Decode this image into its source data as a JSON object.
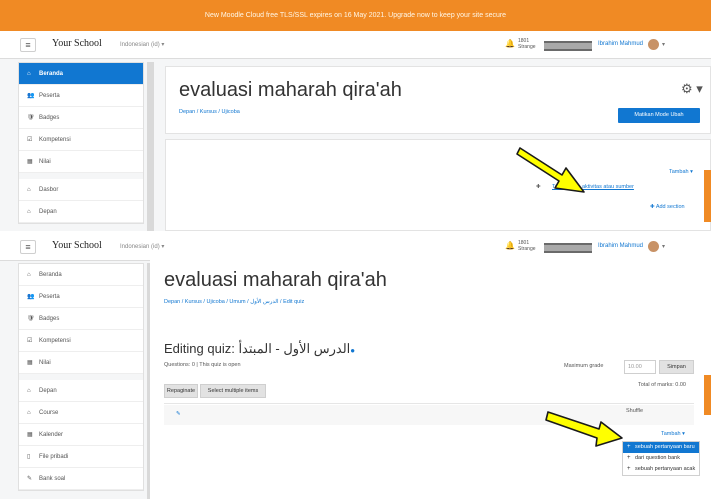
{
  "top": {
    "banner": "New Moodle Cloud free TLS/SSL expires on 16 May 2021. Upgrade now to keep your site secure",
    "navbar": {
      "toggle": "≡",
      "brand": "Your School",
      "lang": "Indonesian (id) ▾",
      "bell": "🔔",
      "chat": "💬",
      "userbox_l1": "1801",
      "userbox_l2": "Strange",
      "username": "Ibrahim Mahmud",
      "avatar_chev": "▾"
    },
    "drawer": [
      {
        "label": "Beranda",
        "icon": "⌂",
        "active": true
      },
      {
        "label": "Peserta",
        "icon": "👥",
        "active": false
      },
      {
        "label": "Badges",
        "icon": "🛡",
        "active": false
      },
      {
        "label": "Kompetensi",
        "icon": "☑",
        "active": false
      },
      {
        "label": "Nilai",
        "icon": "▦",
        "active": false
      },
      {
        "label": "Dasbor",
        "icon": "⌂",
        "active": false
      },
      {
        "label": "Depan",
        "icon": "⌂",
        "active": false
      }
    ],
    "page_title": "evaluasi maharah qira'ah",
    "breadcrumb": "Depan / Kursus / Ujicoba",
    "gear": "⚙ ▾",
    "edit_button": "Matikan Mode Ubah",
    "add_label": "Tambah ▾",
    "add_link": "Tambahkan aktivitas atau sumber",
    "add_link_bullet": "✚",
    "add_section": "✚ Add section"
  },
  "bottom": {
    "navbar": {
      "toggle": "≡",
      "brand": "Your School",
      "lang": "Indonesian (id) ▾",
      "bell": "🔔",
      "chat": "💬",
      "userbox_l1": "1801",
      "userbox_l2": "Strange",
      "username": "Ibrahim Mahmud",
      "avatar_chev": "▾"
    },
    "drawer": [
      {
        "label": "Beranda",
        "icon": "⌂"
      },
      {
        "label": "Peserta",
        "icon": "👥"
      },
      {
        "label": "Badges",
        "icon": "🛡"
      },
      {
        "label": "Kompetensi",
        "icon": "☑"
      },
      {
        "label": "Nilai",
        "icon": "▦"
      },
      {
        "label": "Depan",
        "icon": "⌂"
      },
      {
        "label": "Course",
        "icon": "⌂"
      },
      {
        "label": "Kalender",
        "icon": "▦"
      },
      {
        "label": "File pribadi",
        "icon": "▯"
      },
      {
        "label": "Bank soal",
        "icon": "✎"
      }
    ],
    "page_title": "evaluasi maharah qira'ah",
    "breadcrumb": "Depan / Kursus / Ujicoba / Umum / الدرس الأول / Edit quiz",
    "edit_title_prefix": "Editing quiz: ",
    "edit_title_quiz": "الدرس الأول - المبتدأ",
    "edit_title_bullet": "●",
    "questions_info": "Questions: 0 | This quiz is open",
    "max_grade_label": "Maximum grade",
    "max_grade_value": "10.00",
    "save_button": "Simpan",
    "total_marks": "Total of marks: 0.00",
    "repaginate_button": "Repaginate",
    "select_multiple_button": "Select multiple items",
    "shuffle": "Shuffle",
    "pencil": "✎",
    "add_menu_label": "Tambah ▾",
    "add_menu_items": [
      {
        "label": "sebuah pertanyaan baru",
        "highlight": true
      },
      {
        "label": "dari question bank",
        "highlight": false
      },
      {
        "label": "sebuah pertanyaan acak",
        "highlight": false
      }
    ]
  },
  "colors": {
    "banner": "#f08a24",
    "accent": "#1177d1",
    "arrow_fill": "#ffff00",
    "arrow_stroke": "#1a1a1a"
  },
  "icons": [
    "menu-icon",
    "bell-icon",
    "chat-icon",
    "gear-icon",
    "pencil-icon",
    "plus-icon",
    "pointer-arrow"
  ]
}
